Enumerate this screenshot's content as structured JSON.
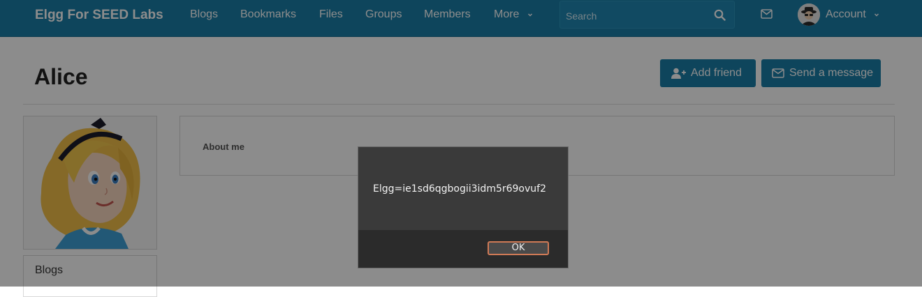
{
  "header": {
    "brand": "Elgg For SEED Labs",
    "nav": [
      "Blogs",
      "Bookmarks",
      "Files",
      "Groups",
      "Members",
      "More"
    ],
    "search_placeholder": "Search",
    "account_label": "Account"
  },
  "profile": {
    "name": "Alice",
    "add_friend_label": "Add friend",
    "send_message_label": "Send a message",
    "about_label": "About me",
    "menu": [
      "Blogs"
    ]
  },
  "alert": {
    "message": "Elgg=ie1sd6qgbogii3idm5r69ovuf2",
    "ok_label": "OK"
  },
  "colors": {
    "topbar": "#1b7fa8",
    "button": "#1b7fa8",
    "dialog_bg": "#2b2b2b",
    "ok_border": "#d07a56"
  }
}
